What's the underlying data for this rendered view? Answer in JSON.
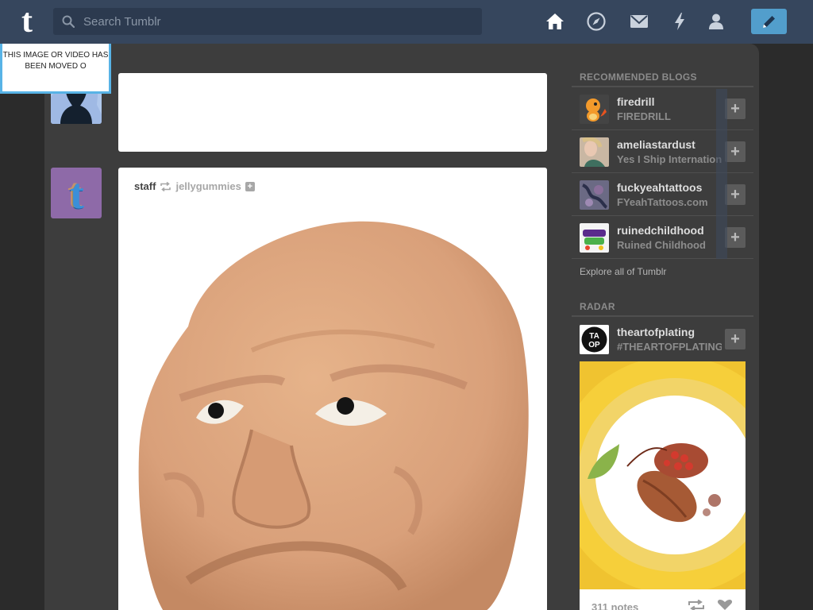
{
  "topbar": {
    "logo": "t",
    "search_placeholder": "Search Tumblr",
    "nav": [
      "home-icon",
      "explore-compass-icon",
      "inbox-mail-icon",
      "activity-bolt-icon",
      "account-person-icon"
    ],
    "compose_icon": "pencil-icon",
    "colors": {
      "bar": "#36465d",
      "search": "#2c3a4f",
      "compose": "#529ecc"
    }
  },
  "moved_notice": "THIS IMAGE OR VIDEO HAS BEEN MOVED O",
  "posts": [
    {
      "author": "staff",
      "reblogged_from": "jellygummies",
      "follow_icon": "plus-icon"
    }
  ],
  "sidebar": {
    "recommended_title": "RECOMMENDED BLOGS",
    "blogs": [
      {
        "name": "firedrill",
        "title": "FIREDRILL"
      },
      {
        "name": "ameliastardust",
        "title": "Yes I Ship International"
      },
      {
        "name": "fuckyeahtattoos",
        "title": "FYeahTattoos.com"
      },
      {
        "name": "ruinedchildhood",
        "title": "Ruined Childhood"
      }
    ],
    "add_label": "+",
    "explore_link": "Explore all of Tumblr",
    "radar_title": "RADAR",
    "radar": {
      "name": "theartofplating",
      "title": "#THEARTOFPLATING",
      "notes": "311 notes"
    }
  }
}
